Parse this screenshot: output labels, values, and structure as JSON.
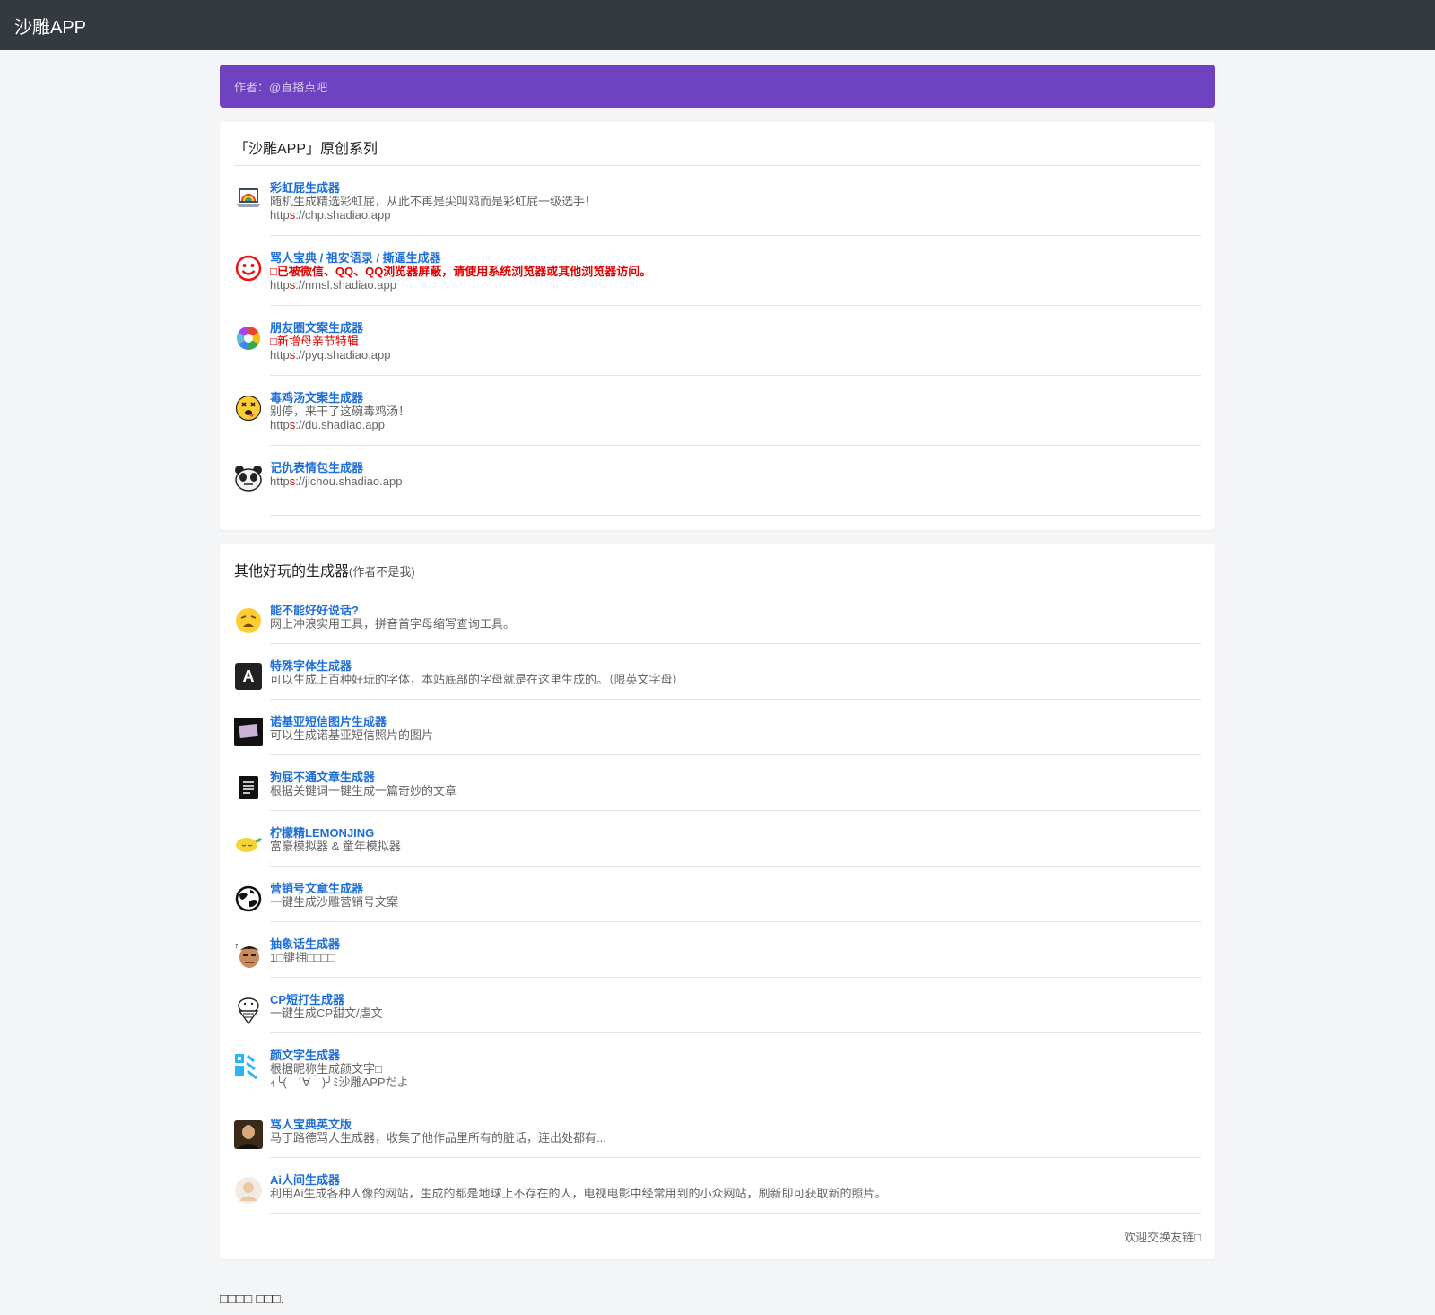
{
  "navbar": {
    "brand": "沙雕APP"
  },
  "author_bar": {
    "text": "作者：@直播点吧"
  },
  "original": {
    "title": "「沙雕APP」原创系列",
    "items": [
      {
        "title": "彩虹屁生成器",
        "desc": "随机生成精选彩虹屁，从此不再是尖叫鸡而是彩虹屁一级选手！",
        "url_prefix": "http",
        "url_s": "s",
        "url_rest": "://chp.shadiao.app",
        "icon": "rainbow-laptop-icon"
      },
      {
        "title": "骂人宝典 / 祖安语录 / 撕逼生成器",
        "desc": "□已被微信、QQ、QQ浏览器屏蔽，请使用系统浏览器或其他浏览器访问。",
        "url_prefix": "http",
        "url_s": "s",
        "url_rest": "://nmsl.shadiao.app",
        "icon": "red-smiley-icon"
      },
      {
        "title": "朋友圈文案生成器",
        "desc": "□新增母亲节特辑",
        "url_prefix": "http",
        "url_s": "s",
        "url_rest": "://pyq.shadiao.app",
        "icon": "aperture-icon"
      },
      {
        "title": "毒鸡汤文案生成器",
        "desc": "别停，来干了这碗毒鸡汤！",
        "url_prefix": "http",
        "url_s": "s",
        "url_rest": "://du.shadiao.app",
        "icon": "dizzy-face-icon"
      },
      {
        "title": "记仇表情包生成器",
        "url_prefix": "http",
        "url_s": "s",
        "url_rest": "://jichou.shadiao.app",
        "icon": "panda-face-icon"
      }
    ]
  },
  "others": {
    "title": "其他好玩的生成器",
    "title_note": "(作者不是我)",
    "items": [
      {
        "title": "能不能好好说话?",
        "desc": "网上冲浪实用工具，拼音首字母缩写查询工具。",
        "icon": "weary-face-icon"
      },
      {
        "title": "特殊字体生成器",
        "desc": "可以生成上百种好玩的字体，本站底部的字母就是在这里生成的。（限英文字母）",
        "icon": "letter-a-icon",
        "letter": "A"
      },
      {
        "title": "诺基亚短信图片生成器",
        "desc": "可以生成诺基亚短信照片的图片",
        "icon": "nokia-screen-icon"
      },
      {
        "title": "狗屁不通文章生成器",
        "desc": "根据关键词一键生成一篇奇妙的文章",
        "icon": "document-icon"
      },
      {
        "title": "柠檬精LEMONJING",
        "desc": "富豪模拟器 & 童年模拟器",
        "icon": "lemon-icon"
      },
      {
        "title": "营销号文章生成器",
        "desc": "一键生成沙雕营销号文案",
        "icon": "globe-icon"
      },
      {
        "title": "抽象话生成器",
        "desc": "1□键拥□□□□",
        "icon": "abstract-face-icon"
      },
      {
        "title": "CP短打生成器",
        "desc": "一键生成CP甜文/虐文",
        "icon": "ice-cream-icon"
      },
      {
        "title": "颜文字生成器",
        "desc": "根据昵称生成颜文字□",
        "desc2": "ｨ╰(　´∀｀)╯ﾐ沙雕APPだよ",
        "icon": "kaomoji-icon"
      },
      {
        "title": "骂人宝典英文版",
        "desc": "马丁路德骂人生成器，收集了他作品里所有的脏话，连出处都有...",
        "icon": "portrait-icon"
      },
      {
        "title": "Ai人间生成器",
        "desc": "利用Ai生成各种人像的网站，生成的都是地球上不存在的人，电视电影中经常用到的小众网站，刷新即可获取新的照片。",
        "icon": "person-avatar-icon"
      }
    ],
    "footer_link": "欢迎交换友链□"
  },
  "copyright": "□□□□ □□□."
}
